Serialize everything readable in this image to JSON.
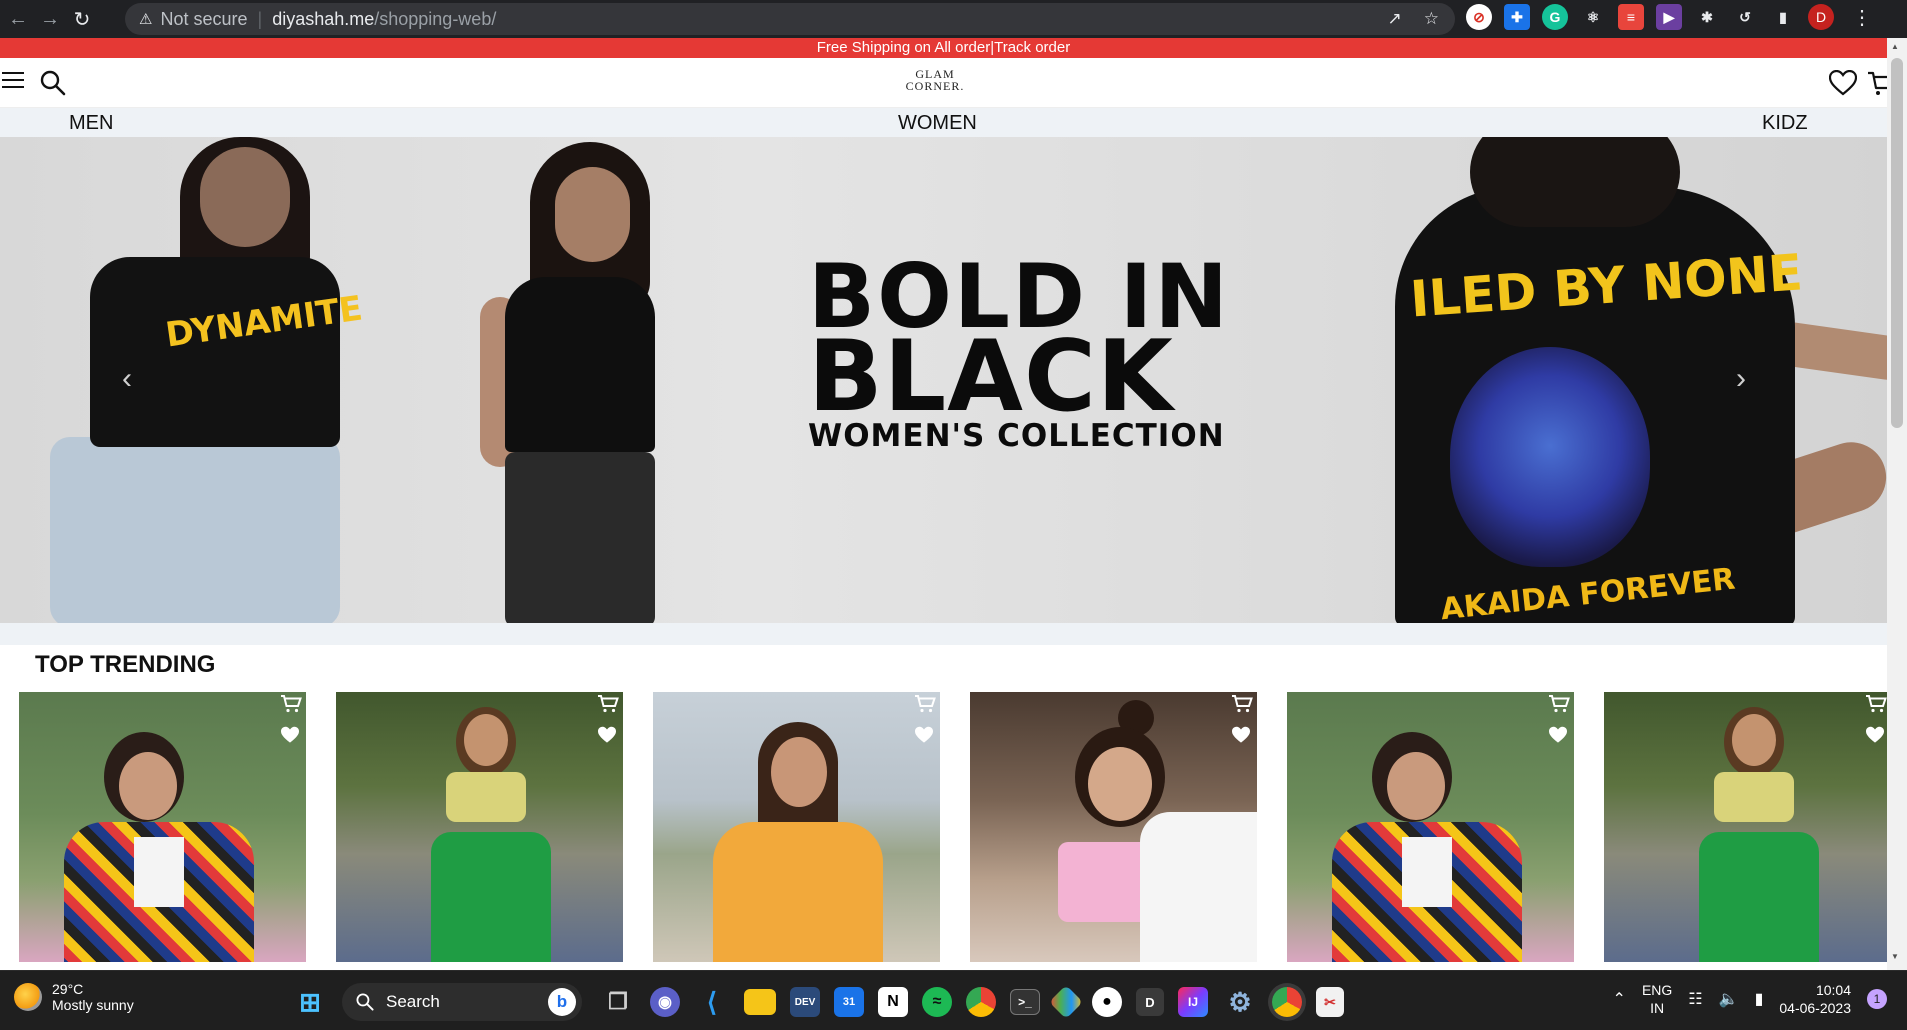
{
  "browser": {
    "security_label": "Not secure",
    "url_host": "diyashah.me",
    "url_path": "/shopping-web/",
    "profile_initial": "D"
  },
  "site": {
    "promo": "Free Shipping on All order|Track order",
    "logo_line1": "GLAM",
    "logo_line2": "CORNER.",
    "categories": [
      "MEN",
      "WOMEN",
      "KIDZ"
    ],
    "hero": {
      "line1": "BOLD IN",
      "line2": "BLACK",
      "line3": "WOMEN'S COLLECTION",
      "tee1_print": "DYNAMITE",
      "tee2_print_top": "ILED BY NONE",
      "tee2_print_bottom": "AKAIDA FOREVER"
    },
    "section_title": "TOP TRENDING",
    "product_count": 6
  },
  "taskbar": {
    "weather_temp": "29°C",
    "weather_desc": "Mostly sunny",
    "search_label": "Search",
    "lang_line1": "ENG",
    "lang_line2": "IN",
    "time": "10:04",
    "date": "04-06-2023",
    "notification_count": "1"
  },
  "colors": {
    "promo_bg": "#e53935",
    "nav_bg": "#eef2f6",
    "chrome_bg": "#202124",
    "taskbar_bg": "#1f1f1f"
  }
}
